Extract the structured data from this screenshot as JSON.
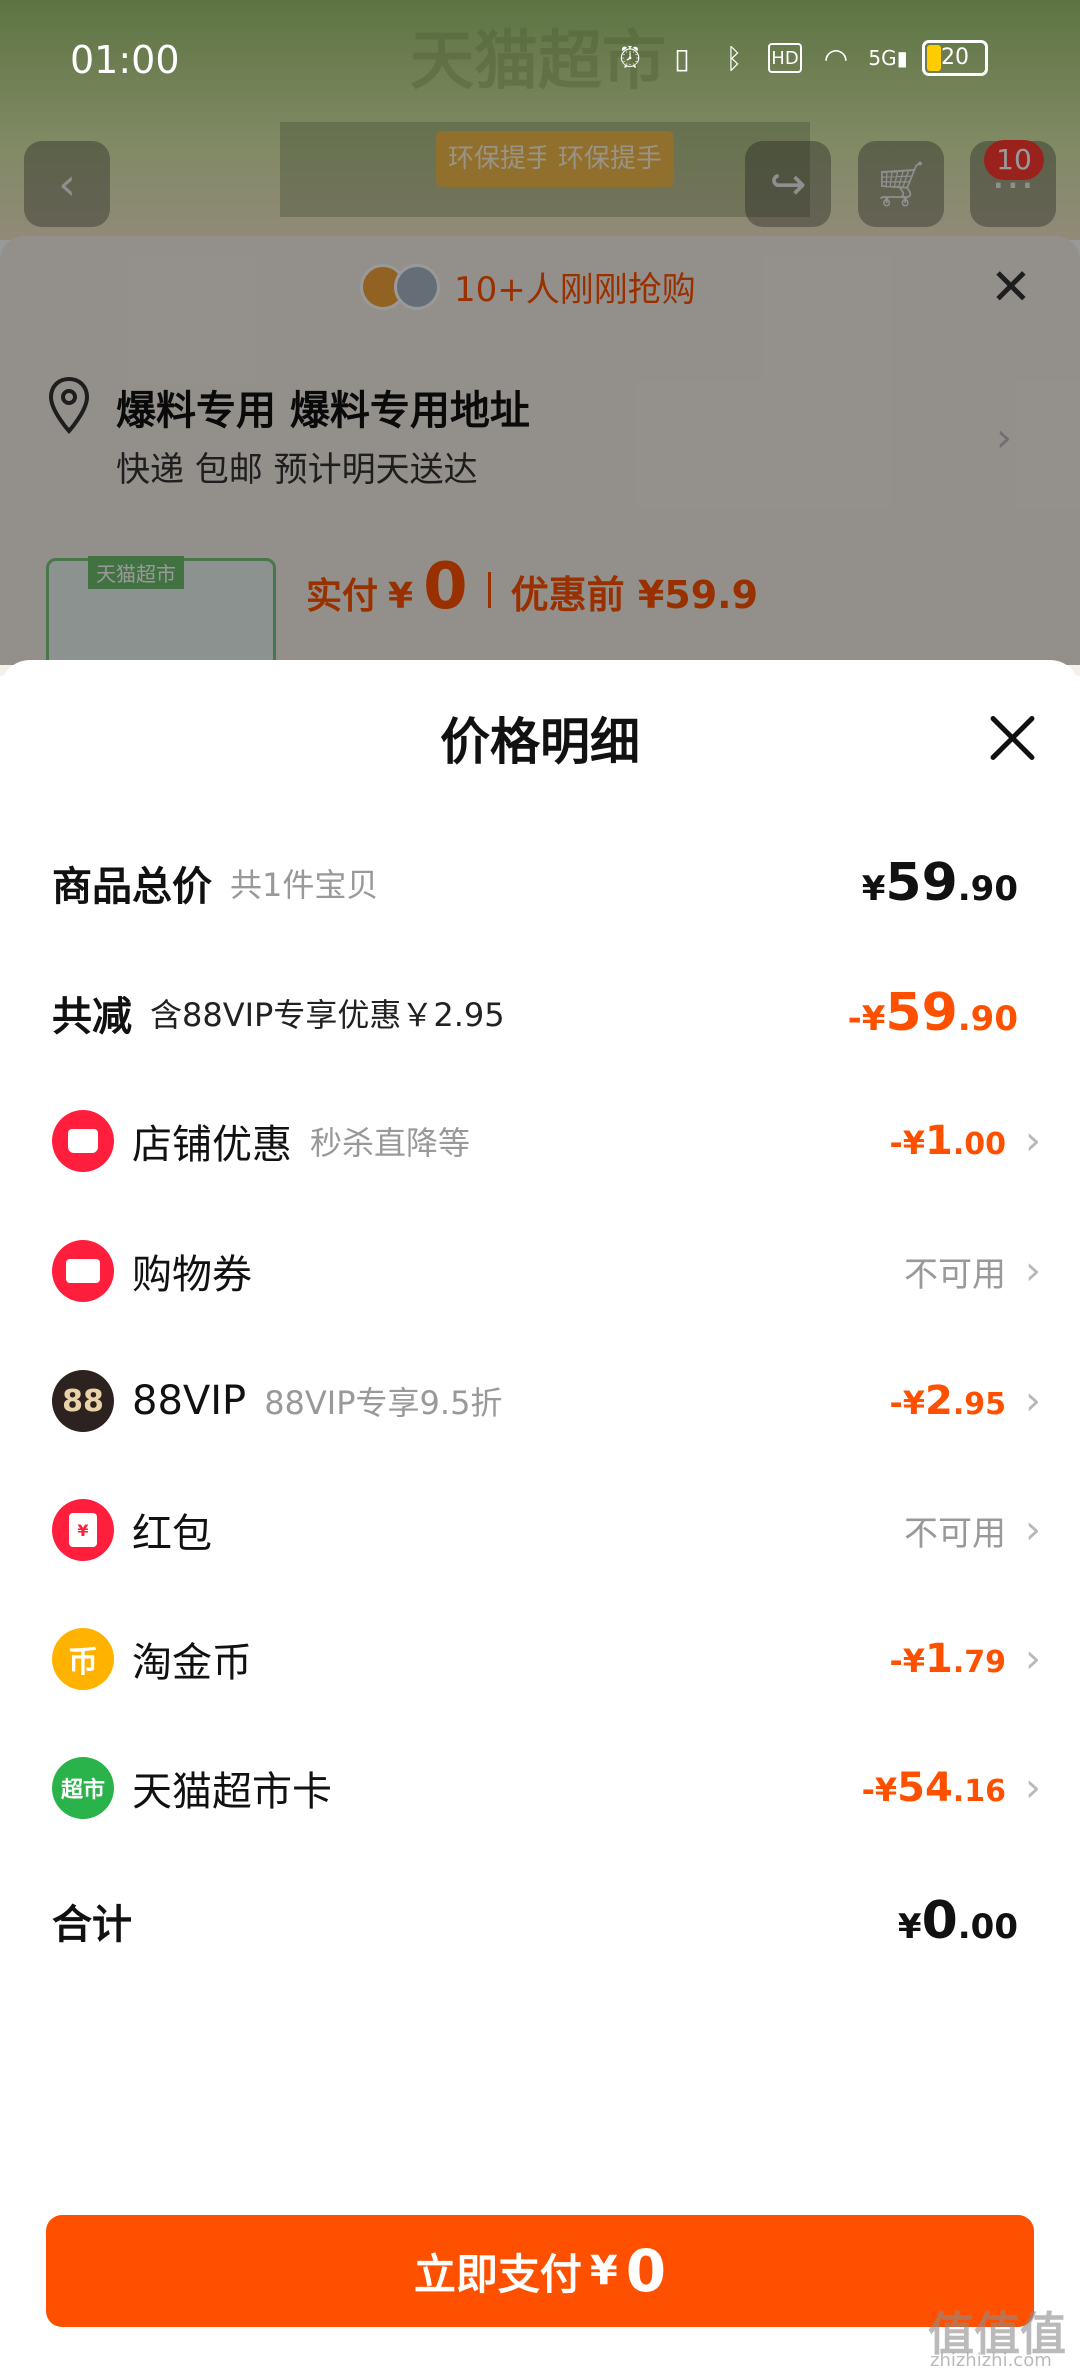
{
  "status_bar": {
    "time": "01:00",
    "battery": "20"
  },
  "background": {
    "watermark_text": "天猫超市",
    "banner_tags": [
      "环保提手",
      "环保提手"
    ],
    "cart_count": "10"
  },
  "order_sheet": {
    "buyers_tip": "10+人刚刚抢购",
    "address_title": "爆料专用 爆料专用地址",
    "delivery_info": "快递 包邮 预计明天送达",
    "product_thumb_label": "天猫超市",
    "pay_label": "实付",
    "pay_currency": "¥",
    "pay_amount": "0",
    "before_discount": "优惠前 ¥59.9"
  },
  "detail": {
    "title": "价格明细",
    "subtotal": {
      "label": "商品总价",
      "note": "共1件宝贝",
      "currency": "¥",
      "int": "59",
      "dec": ".90"
    },
    "total_discount": {
      "label": "共减",
      "note": "含88VIP专享优惠￥2.95",
      "currency": "-¥",
      "int": "59",
      "dec": ".90"
    },
    "items": [
      {
        "icon": "store-icon",
        "label": "店铺优惠",
        "note": "秒杀直降等",
        "currency": "-¥",
        "int": "1",
        "dec": ".00"
      },
      {
        "icon": "coupon-icon",
        "label": "购物券",
        "status": "不可用"
      },
      {
        "icon": "88vip-icon",
        "icon_text": "88",
        "label": "88VIP",
        "note": "88VIP专享9.5折",
        "currency": "-¥",
        "int": "2",
        "dec": ".95"
      },
      {
        "icon": "red-packet-icon",
        "icon_text": "¥",
        "label": "红包",
        "status": "不可用"
      },
      {
        "icon": "gold-coin-icon",
        "icon_text": "币",
        "label": "淘金币",
        "currency": "-¥",
        "int": "1",
        "dec": ".79"
      },
      {
        "icon": "supermarket-card-icon",
        "icon_text": "超市",
        "label": "天猫超市卡",
        "currency": "-¥",
        "int": "54",
        "dec": ".16"
      }
    ],
    "total": {
      "label": "合计",
      "currency": "¥",
      "int": "0",
      "dec": ".00"
    }
  },
  "pay_button": {
    "label": "立即支付",
    "currency": "¥",
    "amount": "0"
  },
  "watermark": {
    "text": "值值值",
    "sub": "zhizhizhi.com"
  },
  "colors": {
    "accent": "#ff5000",
    "muted": "#999999"
  }
}
